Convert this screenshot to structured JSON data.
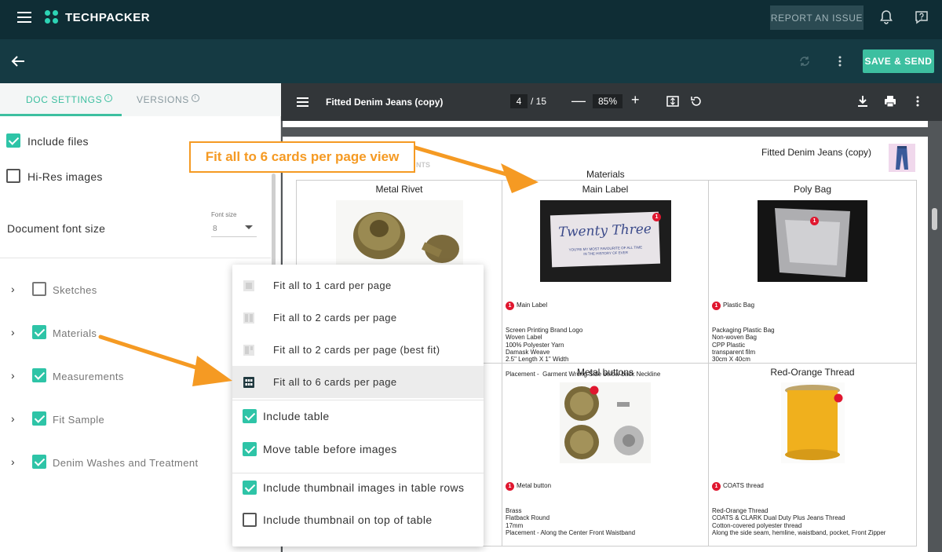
{
  "app": {
    "name": "TECHPACKER"
  },
  "header": {
    "report_label": "REPORT AN ISSUE",
    "save_label": "SAVE & SEND"
  },
  "left_panel": {
    "tabs": [
      {
        "label": "DOC SETTINGS"
      },
      {
        "label": "VERSIONS"
      }
    ],
    "info_glyph": "i",
    "include_files": "Include files",
    "hi_res": "Hi-Res images",
    "font_size_label": "Document font size",
    "font_size_caption": "Font size",
    "font_size_value": "8",
    "sections": [
      {
        "label": "Sketches",
        "checked": false
      },
      {
        "label": "Materials",
        "checked": true
      },
      {
        "label": "Measurements",
        "checked": true
      },
      {
        "label": "Fit Sample",
        "checked": true
      },
      {
        "label": "Denim Washes and Treatment",
        "checked": true
      }
    ]
  },
  "viewer": {
    "title": "Fitted Denim Jeans (copy)",
    "page_current": "4",
    "page_total": "/ 15",
    "zoom": "85%",
    "minus": "—",
    "plus": "+"
  },
  "doc": {
    "title": "Fitted Denim Jeans (copy)",
    "section": "Materials",
    "hidden_text": "NTS",
    "cards": [
      {
        "header": "Metal Rivet"
      },
      {
        "header": "Main Label",
        "badge": "1",
        "desc_title": "Main Label",
        "desc": "Screen Printing Brand Logo\nWoven Label\n100% Polyester Yarn\nDamask Weave\n2.5\" Length X 1\" Width\n\nPlacement -  Garment Wrong Side below back Neckline",
        "label_script": "Twenty Three",
        "label_small": "YOU'RE MY MOST FAVOURITE OF ALL TIME\nIN THE HISTORY OF EVER"
      },
      {
        "header": "Poly Bag",
        "badge": "1",
        "desc_title": "Plastic Bag",
        "desc": "Packaging Plastic Bag\nNon-woven Bag\nCPP Plastic\ntransparent film\n30cm X 40cm"
      },
      {
        "header": "Metal buttons",
        "badge": "1",
        "desc_title": "Metal button",
        "desc": "Brass\nFlatback Round\n17mm\nPlacement - Along the Center Front Waistband"
      },
      {
        "header": "Red-Orange Thread",
        "badge": "1",
        "desc_title": "COATS thread",
        "desc": "Red-Orange Thread\nCOATS & CLARK Dual Duty Plus Jeans Thread\nCotton-covered polyester thread\nAlong the side seam, hemline, waistband, pocket, Front Zipper"
      }
    ]
  },
  "menu": {
    "layout_options": [
      {
        "label": "Fit all to 1 card per page",
        "icon": "one-card-icon"
      },
      {
        "label": "Fit all to 2 cards per page",
        "icon": "two-cards-icon"
      },
      {
        "label": "Fit all to 2 cards per page (best fit)",
        "icon": "best-fit-icon"
      },
      {
        "label": "Fit all to 6 cards per page",
        "icon": "six-cards-icon",
        "selected": true
      }
    ],
    "checks": [
      {
        "label": "Include table",
        "checked": true
      },
      {
        "label": "Move table before images",
        "checked": true
      },
      {
        "label": "Include thumbnail images in table rows",
        "checked": true
      },
      {
        "label": "Include thumbnail on top of table",
        "checked": false
      }
    ]
  },
  "annotation": {
    "callout": "Fit all to 6 cards per page view"
  },
  "colors": {
    "topbar": "#0f2d35",
    "accent": "#3dbfa0",
    "callout": "#f59a23",
    "badge": "#e0172f"
  }
}
